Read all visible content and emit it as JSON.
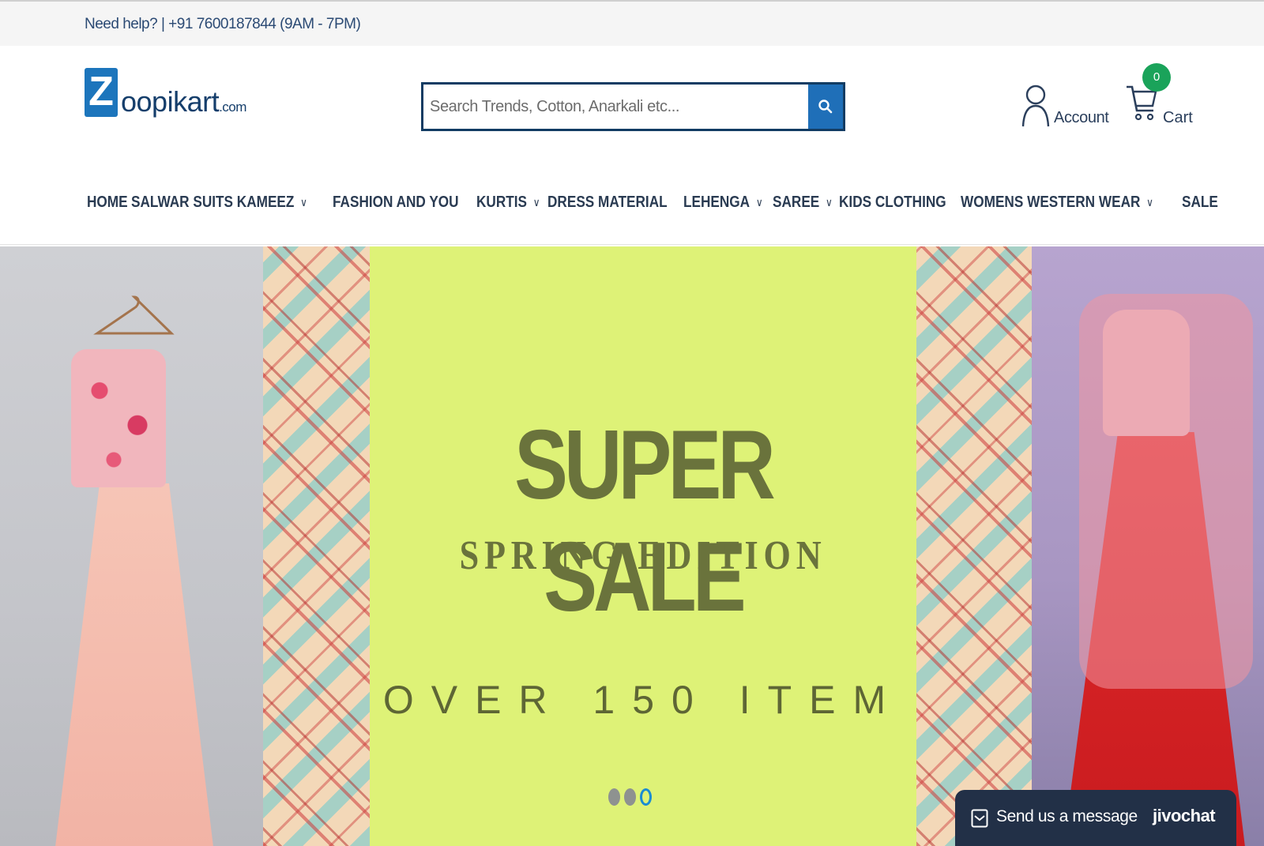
{
  "topbar": {
    "help_text": "Need help? | +91 7600187844 (9AM - 7PM)"
  },
  "logo": {
    "mark": "Z",
    "name": "oopikart",
    "tld": ".com"
  },
  "search": {
    "placeholder": "Search Trends, Cotton, Anarkali etc...",
    "icon": "search-icon"
  },
  "account": {
    "label": "Account",
    "icon": "user-icon"
  },
  "cart": {
    "label": "Cart",
    "count": "0",
    "icon": "cart-icon"
  },
  "nav": {
    "items": [
      {
        "label": "HOME",
        "dropdown": false
      },
      {
        "label": "SALWAR SUITS KAMEEZ",
        "dropdown": true
      },
      {
        "label": "FASHION AND YOU",
        "dropdown": false
      },
      {
        "label": "KURTIS",
        "dropdown": true
      },
      {
        "label": "DRESS MATERIAL",
        "dropdown": false
      },
      {
        "label": "LEHENGA",
        "dropdown": true
      },
      {
        "label": "SAREE",
        "dropdown": true
      },
      {
        "label": "KIDS CLOTHING",
        "dropdown": false
      },
      {
        "label": "WOMENS WESTERN WEAR",
        "dropdown": true
      },
      {
        "label": "SALE",
        "dropdown": false
      }
    ]
  },
  "hero": {
    "title": "SUPER SALE",
    "subtitle": "SPRING EDITION",
    "count_text": "OVER 150 ITEM",
    "slides": 3,
    "active_slide": 3
  },
  "chat": {
    "label": "Send us a message",
    "brand": "jivochat"
  },
  "colors": {
    "brand_blue": "#1c75bc",
    "search_border": "#123c63",
    "promo_bg": "#def277",
    "promo_text": "#6a733c",
    "badge_green": "#1aa35a",
    "chat_bg": "#223047"
  }
}
